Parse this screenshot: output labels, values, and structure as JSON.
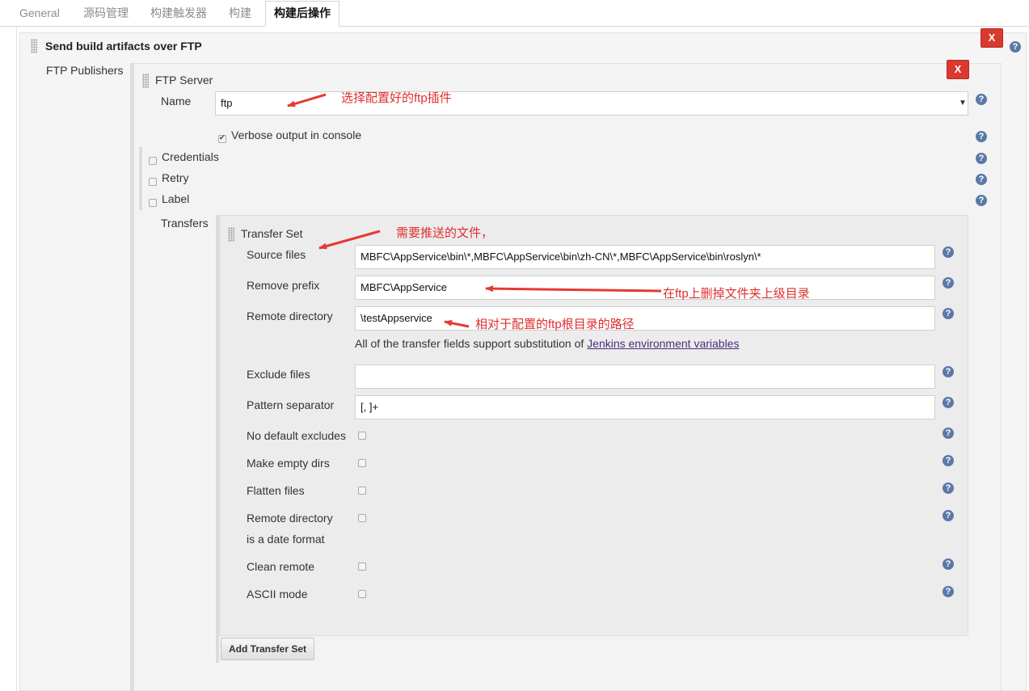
{
  "tabs": [
    "General",
    "源码管理",
    "构建触发器",
    "构建",
    "构建后操作"
  ],
  "section": {
    "title": "Send build artifacts over FTP",
    "publishers_label": "FTP Publishers",
    "delete_label": "X"
  },
  "ftp_server": {
    "title": "FTP Server",
    "name_label": "Name",
    "name_value": "ftp",
    "verbose_label": "Verbose output in console",
    "verbose_checked": true,
    "credentials_label": "Credentials",
    "retry_label": "Retry",
    "label_label": "Label",
    "transfers_label": "Transfers",
    "delete_label": "X"
  },
  "transfer_set": {
    "title": "Transfer Set",
    "source_files_label": "Source files",
    "source_files_value": "MBFC\\AppService\\bin\\*,MBFC\\AppService\\bin\\zh-CN\\*,MBFC\\AppService\\bin\\roslyn\\*",
    "remove_prefix_label": "Remove prefix",
    "remove_prefix_value": "MBFC\\AppService",
    "remote_dir_label": "Remote directory",
    "remote_dir_value": "\\testAppservice",
    "env_note_prefix": "All of the transfer fields support substitution of ",
    "env_link": "Jenkins environment variables",
    "exclude_files_label": "Exclude files",
    "exclude_files_value": "",
    "pattern_sep_label": "Pattern separator",
    "pattern_sep_value": "[, ]+",
    "no_default_excludes_label": "No default excludes",
    "make_empty_dirs_label": "Make empty dirs",
    "flatten_files_label": "Flatten files",
    "remote_date_label_1": "Remote directory",
    "remote_date_label_2": "is a date format",
    "clean_remote_label": "Clean remote",
    "ascii_mode_label": "ASCII mode",
    "add_button": "Add Transfer Set"
  },
  "annotations": {
    "select_plugin": "选择配置好的ftp插件",
    "files_to_push": "需要推送的文件，",
    "remove_parent": "在ftp上删掉文件夹上级目录",
    "relative_path": "相对于配置的ftp根目录的路径"
  },
  "help_glyph": "?",
  "colors": {
    "annotation": "#e02e2e",
    "delete_button": "#d9392f",
    "help_icon": "#5b79a8",
    "link": "#4d2c7a"
  }
}
